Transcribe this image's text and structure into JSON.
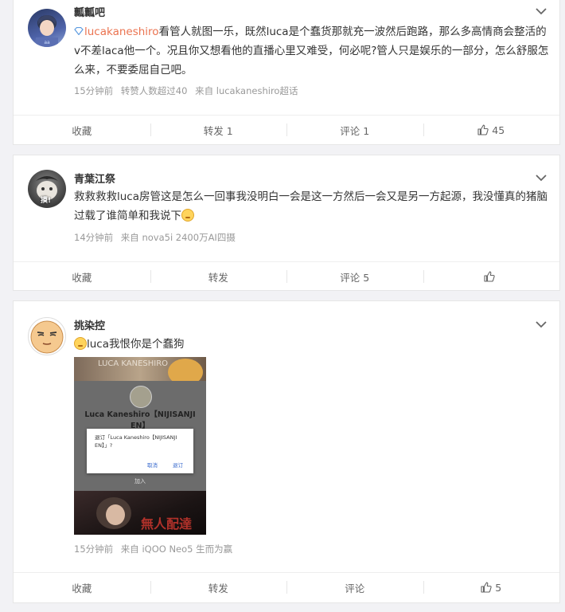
{
  "posts": [
    {
      "username": "瓤瓤吧",
      "mention": "lucakaneshiro",
      "text": "看管人就图一乐，既然luca是个蠢货那就充一波然后跑路，那么多高情商会整活的v不差laca他一个。况且你又想看他的直播心里又难受，何必呢?管人只是娱乐的一部分，怎么舒服怎么来，不要委屈自己吧。",
      "time": "15分钟前",
      "extra": "转赞人数超过40",
      "source": "来自 lucakaneshiro超话",
      "actions": {
        "collect": "收藏",
        "repost": "转发 1",
        "comment": "评论 1",
        "like": "45"
      }
    },
    {
      "username": "青葉江祭",
      "avatar_text": "摸!",
      "text": "救救救救luca房管这是怎么一回事我没明白一会是这一方然后一会又是另一方起源，我没懂真的猪脑过载了谁简单和我说下",
      "time": "14分钟前",
      "source": "来自 nova5i 2400万AI四摄",
      "actions": {
        "collect": "收藏",
        "repost": "转发",
        "comment": "评论 5",
        "like": ""
      }
    },
    {
      "username": "挑染控",
      "text": "luca我恨你是个蠢狗",
      "image": {
        "header_text": "LUCA KANESHIRO",
        "channel": "Luca Kaneshiro【NIJISANJI EN】",
        "dialog_text": "退订「Luca Kaneshiro【NIJISANJI EN】」?",
        "cancel": "取消",
        "confirm": "退订",
        "join": "加入",
        "overlay": "無人配達"
      },
      "time": "15分钟前",
      "source": "来自 iQOO Neo5 生而为赢",
      "actions": {
        "collect": "收藏",
        "repost": "转发",
        "comment": "评论",
        "like": "5"
      }
    }
  ]
}
